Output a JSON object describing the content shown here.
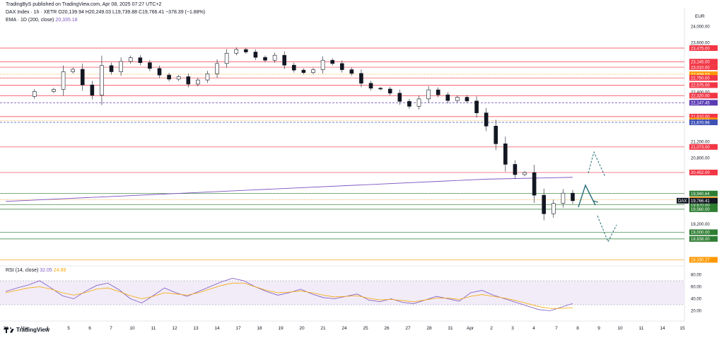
{
  "header": {
    "publisher": "TradingByS published on TradingView.com, Apr 08, 2025 07:27 UTC+2",
    "symbol_line": "DAX Index · 1h · XETR   O20,139.94  H20,249.03  L19,739.88  C19,766.41  −378.39 (−1.88%)",
    "ema_label": "EMA · 1D (200, close)",
    "ema_value": "20,335.18",
    "rsi_label": "RSI (14, close)",
    "rsi_value": "32.05",
    "rsi_ma_value": "24.89"
  },
  "footer": {
    "brand": "TradingView"
  },
  "chart_data": [
    {
      "type": "candlestick",
      "title": "DAX Index · 1h · XETR",
      "currency": "EUR",
      "ylim": [
        18200,
        24300
      ],
      "y_ticks": [
        "24,000.00",
        "23,600.00",
        "22,400.00",
        "21,200.00",
        "20,800.00",
        "19,200.00",
        "18,838.00"
      ],
      "x_tick_labels": [
        "28",
        "Mar",
        "4",
        "5",
        "6",
        "7",
        "10",
        "11",
        "12",
        "13",
        "14",
        "17",
        "18",
        "19",
        "20",
        "21",
        "24",
        "25",
        "26",
        "27",
        "28",
        "31",
        "Apr",
        "2",
        "3",
        "4",
        "7",
        "8",
        "9",
        "10",
        "11",
        "14",
        "15"
      ],
      "price_path": [
        [
          0,
          22300
        ],
        [
          3,
          22420
        ],
        [
          5,
          22470
        ],
        [
          6,
          22900
        ],
        [
          7,
          22960
        ],
        [
          8,
          22580
        ],
        [
          9,
          22330
        ],
        [
          10,
          23050
        ],
        [
          11,
          22900
        ],
        [
          12,
          23150
        ],
        [
          13,
          23240
        ],
        [
          14,
          23120
        ],
        [
          15,
          22980
        ],
        [
          16,
          22820
        ],
        [
          17,
          22720
        ],
        [
          18,
          22780
        ],
        [
          19,
          22600
        ],
        [
          20,
          22700
        ],
        [
          21,
          22850
        ],
        [
          22,
          23100
        ],
        [
          23,
          23350
        ],
        [
          24,
          23440
        ],
        [
          25,
          23380
        ],
        [
          26,
          23250
        ],
        [
          27,
          23180
        ],
        [
          28,
          23300
        ],
        [
          29,
          23060
        ],
        [
          30,
          22940
        ],
        [
          31,
          22880
        ],
        [
          32,
          22950
        ],
        [
          33,
          23180
        ],
        [
          34,
          23100
        ],
        [
          35,
          22950
        ],
        [
          36,
          22860
        ],
        [
          37,
          22620
        ],
        [
          38,
          22500
        ],
        [
          39,
          22480
        ],
        [
          40,
          22380
        ],
        [
          41,
          22180
        ],
        [
          42,
          22060
        ],
        [
          43,
          22240
        ],
        [
          44,
          22460
        ],
        [
          45,
          22340
        ],
        [
          46,
          22200
        ],
        [
          47,
          22280
        ],
        [
          48,
          22190
        ],
        [
          49,
          21900
        ],
        [
          50,
          21580
        ],
        [
          51,
          21150
        ],
        [
          52,
          20650
        ],
        [
          53,
          20400
        ],
        [
          54,
          20450
        ],
        [
          55,
          19900
        ],
        [
          56,
          19450
        ],
        [
          57,
          19700
        ],
        [
          58,
          19950
        ],
        [
          59,
          19766
        ]
      ],
      "ema_200_path": [
        [
          0,
          19750
        ],
        [
          25,
          20020
        ],
        [
          50,
          20290
        ],
        [
          59,
          20335
        ]
      ],
      "last_price": "19,766.41",
      "last_price_label": "DAX",
      "levels": [
        {
          "value": 23475,
          "label": "23,475.00",
          "style": "solid",
          "color": "#f23645"
        },
        {
          "value": 23145,
          "label": "23,145.00",
          "style": "solid",
          "color": "#f23645"
        },
        {
          "value": 23010,
          "label": "23,010.00",
          "style": "solid",
          "color": "#f23645"
        },
        {
          "value": 22839,
          "label": "22,839.03",
          "style": "dotted",
          "color": "#ff9800"
        },
        {
          "value": 22750,
          "label": "22,750.00",
          "style": "solid",
          "color": "#f23645"
        },
        {
          "value": 22575,
          "label": "22,575.00",
          "style": "solid",
          "color": "#f23645"
        },
        {
          "value": 22320,
          "label": "22,320.00",
          "style": "solid",
          "color": "#f23645"
        },
        {
          "value": 22147.45,
          "label": "22,147.45",
          "style": "dashed",
          "color": "#5b3bb3"
        },
        {
          "value": 21810,
          "label": "21,810.00",
          "style": "solid",
          "color": "#f23645"
        },
        {
          "value": 21717.39,
          "label": "21,717.39",
          "style": "dotted",
          "color": "#ff9800"
        },
        {
          "value": 21670.96,
          "label": "21,670.96",
          "style": "dashed",
          "color": "#3f51b5"
        },
        {
          "value": 21073,
          "label": "21,073.00",
          "style": "solid",
          "color": "#f23645"
        },
        {
          "value": 20452,
          "label": "20,452.00",
          "style": "solid",
          "color": "#f23645"
        },
        {
          "value": 19940.64,
          "label": "19,940.64",
          "style": "solid",
          "color": "#2e7d32"
        },
        {
          "value": 19789.62,
          "label": "19,789.62",
          "style": "dotted",
          "color": "#ff9800"
        },
        {
          "value": 19670,
          "label": "19,670.00",
          "style": "solid",
          "color": "#2e7d32"
        },
        {
          "value": 19560,
          "label": "19,560.00",
          "style": "solid",
          "color": "#2e7d32"
        },
        {
          "value": 19000,
          "label": "19,000.00",
          "style": "solid",
          "color": "#2e7d32"
        },
        {
          "value": 18838,
          "label": "18,838.00",
          "style": "solid",
          "color": "#2e7d32"
        },
        {
          "value": 18330.27,
          "label": "18,330.27",
          "style": "solid",
          "color": "#ff9800"
        }
      ]
    },
    {
      "type": "line",
      "title": "RSI (14, close)",
      "ylim": [
        10,
        90
      ],
      "y_ticks": [
        "80.00",
        "60.00",
        "40.00",
        "20.00"
      ],
      "band": [
        30,
        70
      ],
      "series": [
        {
          "values": [
            52,
            58,
            63,
            70,
            58,
            45,
            40,
            52,
            62,
            66,
            55,
            40,
            33,
            45,
            58,
            50,
            44,
            52,
            60,
            68,
            74,
            70,
            60,
            52,
            46,
            50,
            56,
            48,
            42,
            40,
            44,
            48,
            38,
            35,
            40,
            34,
            32,
            38,
            44,
            40,
            36,
            50,
            54,
            46,
            40,
            34,
            28,
            22,
            20,
            26,
            32
          ]
        },
        {
          "values": [
            50,
            54,
            58,
            60,
            56,
            50,
            46,
            50,
            56,
            58,
            52,
            45,
            40,
            44,
            50,
            48,
            46,
            50,
            56,
            62,
            66,
            66,
            60,
            54,
            50,
            51,
            53,
            50,
            46,
            43,
            44,
            45,
            41,
            38,
            39,
            37,
            35,
            38,
            41,
            41,
            39,
            44,
            47,
            44,
            41,
            37,
            32,
            27,
            24,
            24,
            25
          ]
        }
      ]
    }
  ]
}
